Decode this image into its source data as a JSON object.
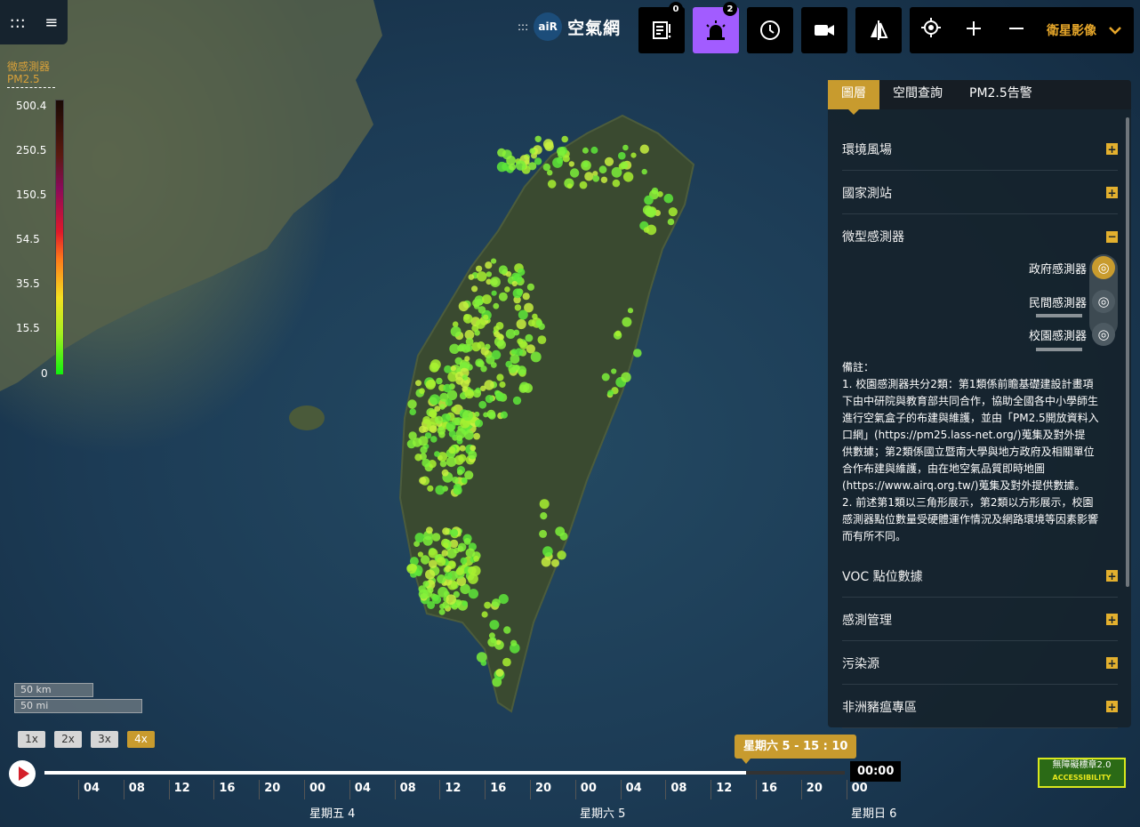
{
  "app": {
    "logo_mark": "aiR",
    "logo_dots": ":::",
    "title": "空氣網"
  },
  "top_menu": {
    "grid_icon": ":::",
    "menu_icon": "≡"
  },
  "legend": {
    "title": "微感測器",
    "subtitle": "PM2.5",
    "ticks": [
      "500.4",
      "250.5",
      "150.5",
      "54.5",
      "35.5",
      "15.5",
      "0"
    ]
  },
  "toolbar": {
    "notice_badge": "0",
    "alarm_badge": "2",
    "basemap_label": "衛星影像",
    "icons": [
      "notice-icon",
      "alarm-icon",
      "history-icon",
      "camera-icon",
      "compare-icon",
      "locate-icon",
      "zoom-in-icon",
      "zoom-out-icon",
      "chevron-down-icon"
    ],
    "accent": "#e7a72a",
    "alarm_color": "#a25cff"
  },
  "panel": {
    "tabs": [
      "圖層",
      "空間查詢",
      "PM2.5告警"
    ],
    "sections_top": [
      {
        "label": "環境風場",
        "sign": "+"
      },
      {
        "label": "國家測站",
        "sign": "+"
      },
      {
        "label": "微型感測器",
        "sign": "−"
      }
    ],
    "sub_items": [
      "政府感測器",
      "民間感測器",
      "校園感測器"
    ],
    "note_title": "備註：",
    "note_lines": [
      "1. 校園感測器共分2類：第1類係前瞻基礎建設計畫項",
      "下由中研院與教育部共同合作，協助全國各中小學師生",
      "進行空氣盒子的布建與維護，並由「PM2.5開放資料入",
      "口網」(https://pm25.lass-net.org/)蒐集及對外提",
      "供數據；第2類係國立暨南大學與地方政府及相關單位",
      "合作布建與維護，由在地空氣品質即時地圖",
      "(https://www.airq.org.tw/)蒐集及對外提供數據。",
      "2. 前述第1類以三角形展示，第2類以方形展示，校園",
      "感測器點位數量受硬體運作情況及網路環境等因素影響",
      "而有所不同。"
    ],
    "sections_bottom": [
      {
        "label": "VOC 點位數據",
        "sign": "+"
      },
      {
        "label": "感測管理",
        "sign": "+"
      },
      {
        "label": "污染源",
        "sign": "+"
      },
      {
        "label": "非洲豬瘟專區",
        "sign": "+"
      }
    ]
  },
  "scale": {
    "km": "50 km",
    "mi": "50 mi"
  },
  "speeds": [
    "1x",
    "2x",
    "3x",
    "4x"
  ],
  "timeline": {
    "current": "星期六 5 - 15 : 10",
    "end_time": "00:00",
    "ticks": [
      "04",
      "08",
      "12",
      "16",
      "20",
      "00",
      "04",
      "08",
      "12",
      "16",
      "20",
      "00",
      "04",
      "08",
      "12",
      "16",
      "20",
      "00"
    ],
    "days": [
      "星期五 4",
      "星期六 5",
      "星期日 6"
    ],
    "progress": 0.877
  },
  "badge": {
    "line1": "無障礙標章2.0",
    "line2": "ACCESSIBILITY"
  }
}
